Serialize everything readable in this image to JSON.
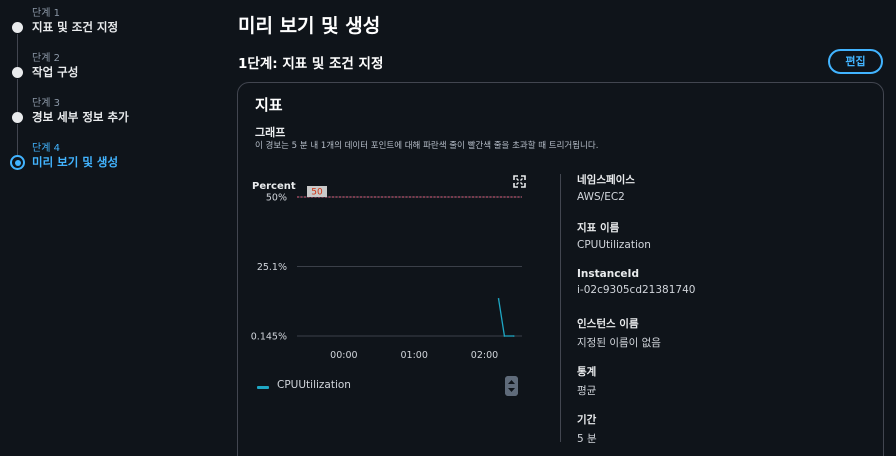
{
  "wizard": {
    "steps": [
      {
        "number": "단계 1",
        "label": "지표 및 조건 지정"
      },
      {
        "number": "단계 2",
        "label": "작업 구성"
      },
      {
        "number": "단계 3",
        "label": "경보 세부 정보 추가"
      },
      {
        "number": "단계 4",
        "label": "미리 보기 및 생성"
      }
    ],
    "active_step": 4
  },
  "header": {
    "title": "미리 보기 및 생성",
    "section_title": "1단계: 지표 및 조건 지정",
    "edit_label": "편집"
  },
  "card": {
    "title": "지표",
    "graph_title": "그래프",
    "graph_description": "이 경보는 5 분 내 1개의 데이터 포인트에 대해 파란색 줄이 빨간색 줄을 초과할 때 트리거됩니다.",
    "legend": {
      "series_name": "CPUUtilization",
      "color": "#1ea7c4"
    }
  },
  "chart_data": {
    "type": "line",
    "ylabel": "Percent",
    "y_ticks": [
      "50%",
      "25.1%",
      "0.145%"
    ],
    "x_ticks": [
      "00:00",
      "01:00",
      "02:00"
    ],
    "threshold": {
      "value": 50,
      "label": "50",
      "color": "#e0607e"
    },
    "series": [
      {
        "name": "CPUUtilization",
        "color": "#1ea7c4",
        "x": [
          "02:12",
          "02:17",
          "02:25"
        ],
        "values": [
          13.5,
          0.145,
          0.145
        ]
      }
    ],
    "ylim": [
      0.145,
      50
    ],
    "xlim": [
      "23:20",
      "02:32"
    ],
    "grid": true
  },
  "details": [
    {
      "key": "네임스페이스",
      "value": "AWS/EC2"
    },
    {
      "key": "지표 이름",
      "value": "CPUUtilization"
    },
    {
      "key": "InstanceId",
      "value": "i-02c9305cd21381740"
    },
    {
      "key": "인스턴스 이름",
      "value": "지정된 이름이 없음"
    },
    {
      "key": "통계",
      "value": "평균"
    },
    {
      "key": "기간",
      "value": "5 분"
    }
  ]
}
